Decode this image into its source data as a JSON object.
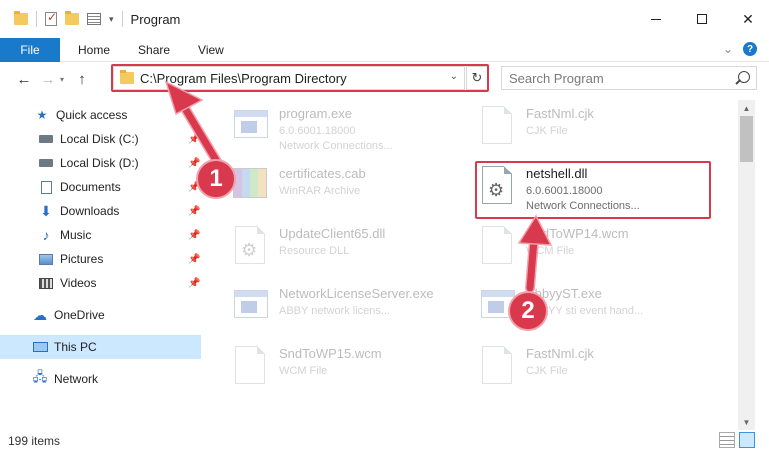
{
  "window": {
    "title": "Program"
  },
  "ribbon": {
    "tabs": [
      "File",
      "Home",
      "Share",
      "View"
    ],
    "help": "?"
  },
  "navigation": {
    "back": "←",
    "forward": "→",
    "up": "↑",
    "address": "C:\\Program Files\\Program Directory",
    "refresh": "↻",
    "search_placeholder": "Search Program"
  },
  "sidebar": {
    "items": [
      {
        "label": "Quick access",
        "icon": "star-icon",
        "pinned": false
      },
      {
        "label": "Local Disk (C:)",
        "icon": "drive-icon",
        "pinned": true
      },
      {
        "label": "Local Disk (D:)",
        "icon": "drive-icon",
        "pinned": true
      },
      {
        "label": "Documents",
        "icon": "documents-icon",
        "pinned": true
      },
      {
        "label": "Downloads",
        "icon": "download-icon",
        "pinned": true
      },
      {
        "label": "Music",
        "icon": "music-icon",
        "pinned": true
      },
      {
        "label": "Pictures",
        "icon": "pictures-icon",
        "pinned": true
      },
      {
        "label": "Videos",
        "icon": "videos-icon",
        "pinned": true
      },
      {
        "label": "OneDrive",
        "icon": "cloud-icon",
        "pinned": false
      },
      {
        "label": "This PC",
        "icon": "computer-icon",
        "pinned": false,
        "selected": true
      },
      {
        "label": "Network",
        "icon": "network-icon",
        "pinned": false
      }
    ]
  },
  "files": [
    {
      "name": "program.exe",
      "line1": "6.0.6001.18000",
      "line2": "Network Connections...",
      "icon": "exe-icon",
      "faded": true
    },
    {
      "name": "FastNml.cjk",
      "line1": "CJK File",
      "line2": "",
      "icon": "document-icon",
      "faded": true
    },
    {
      "name": "certificates.cab",
      "line1": "WinRAR Archive",
      "line2": "",
      "icon": "archive-icon",
      "faded": true
    },
    {
      "name": "netshell.dll",
      "line1": "6.0.6001.18000",
      "line2": "Network Connections...",
      "icon": "dll-gear-icon",
      "faded": false
    },
    {
      "name": "UpdateClient65.dll",
      "line1": "Resource DLL",
      "line2": "",
      "icon": "dll-gear-icon",
      "faded": true
    },
    {
      "name": "SndToWP14.wcm",
      "line1": "WCM File",
      "line2": "",
      "icon": "document-icon",
      "faded": true
    },
    {
      "name": "NetworkLicenseServer.exe",
      "line1": "ABBY network licens...",
      "line2": "",
      "icon": "exe-icon",
      "faded": true
    },
    {
      "name": "AbbyyST.exe",
      "line1": "ABBYY sti event hand...",
      "line2": "",
      "icon": "exe-icon",
      "faded": true
    },
    {
      "name": "SndToWP15.wcm",
      "line1": "WCM File",
      "line2": "",
      "icon": "document-icon",
      "faded": true
    },
    {
      "name": "FastNml.cjk",
      "line1": "CJK File",
      "line2": "",
      "icon": "document-icon",
      "faded": true
    }
  ],
  "status": {
    "count": "199 items"
  },
  "markers": [
    "1",
    "2"
  ],
  "colors": {
    "accent": "#1979ca",
    "highlight": "#d8394d",
    "selected": "#cce8ff"
  }
}
